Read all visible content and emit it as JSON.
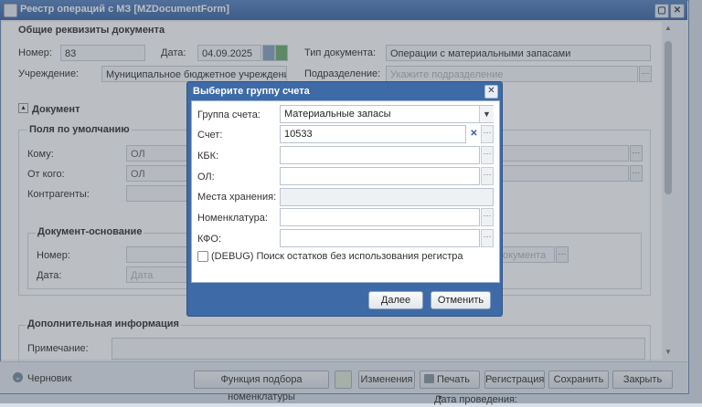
{
  "window": {
    "title": "Реестр операций с МЗ [MZDocumentForm]"
  },
  "general": {
    "legend": "Общие реквизиты документа",
    "number_label": "Номер:",
    "number_value": "83",
    "date_label": "Дата:",
    "date_value": "04.09.2025",
    "doc_type_label": "Тип документа:",
    "doc_type_value": "Операции с материальными запасами",
    "institution_label": "Учреждение:",
    "institution_value": "Муниципальное бюджетное учреждение",
    "division_label": "Подразделение:",
    "division_placeholder": "Укажите подразделение"
  },
  "document": {
    "legend": "Документ",
    "defaults_legend": "Поля по умолчанию",
    "to_label": "Кому:",
    "to_value": "ОЛ",
    "from_label": "От кого:",
    "from_value": "ОЛ",
    "counterparty_label": "Контрагенты:",
    "basis_legend": "Документ-основание",
    "basis_number_label": "Номер:",
    "basis_date_label": "Дата:",
    "basis_date_placeholder": "Дата",
    "basis_doc_placeholder": "окумента"
  },
  "extra": {
    "legend": "Дополнительная информация",
    "note_label": "Примечание:"
  },
  "footer": {
    "status": "Черновик",
    "btn_nomenclature": "Функция подбора номенклатуры",
    "btn_changes": "Изменения",
    "btn_print": "Печать",
    "btn_register": "Регистрация",
    "btn_save": "Сохранить",
    "btn_close": "Закрыть",
    "below_text": "Дата проведения:"
  },
  "dialog": {
    "title": "Выберите группу счета",
    "account_group_label": "Группа счета:",
    "account_group_value": "Материальные запасы",
    "account_label": "Счет:",
    "account_value": "10533",
    "kbk_label": "КБК:",
    "ol_label": "ОЛ:",
    "storage_label": "Места хранения:",
    "nomenclature_label": "Номенклатура:",
    "kfo_label": "КФО:",
    "debug_checkbox_label": "(DEBUG) Поиск остатков без использования регистра",
    "next_button": "Далее",
    "cancel_button": "Отменить"
  }
}
